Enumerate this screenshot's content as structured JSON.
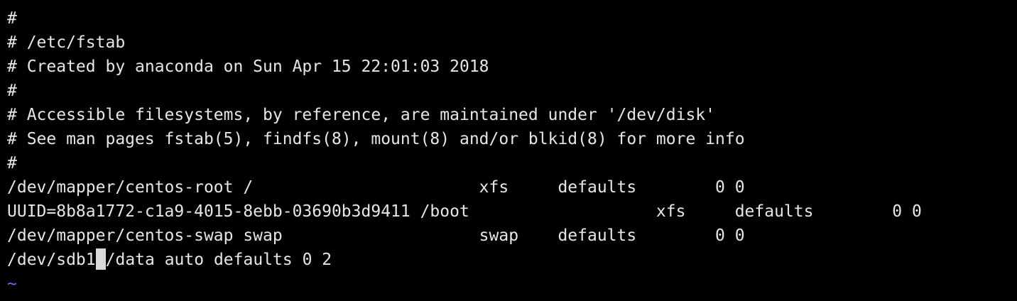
{
  "editor": {
    "lines": [
      "#",
      "# /etc/fstab",
      "# Created by anaconda on Sun Apr 15 22:01:03 2018",
      "#",
      "# Accessible filesystems, by reference, are maintained under '/dev/disk'",
      "# See man pages fstab(5), findfs(8), mount(8) and/or blkid(8) for more info",
      "#",
      "/dev/mapper/centos-root /                       xfs     defaults        0 0",
      "UUID=8b8a1772-c1a9-4015-8ebb-03690b3d9411 /boot                   xfs     defaults        0 0",
      "/dev/mapper/centos-swap swap                    swap    defaults        0 0"
    ],
    "cursor_line": {
      "before": "/dev/sdb1",
      "after": "/data auto defaults 0 2"
    },
    "empty_line_marker": "~"
  }
}
